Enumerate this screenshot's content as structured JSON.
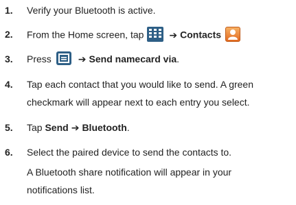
{
  "steps": [
    {
      "num": "1.",
      "text": "Verify your Bluetooth is active."
    },
    {
      "num": "2.",
      "pre": "From the Home screen, tap",
      "arrow": "➔",
      "bold": "Contacts",
      "icon1": "apps-grid-icon",
      "icon2": "contacts-icon"
    },
    {
      "num": "3.",
      "pre": "Press",
      "arrow": "➔",
      "bold": "Send namecard via",
      "post": ".",
      "icon1": "menu-icon"
    },
    {
      "num": "4.",
      "line1": "Tap each contact that you would like to send. A green",
      "line2": "checkmark will appear next to each entry you select."
    },
    {
      "num": "5.",
      "pre": "Tap",
      "bold1": "Send",
      "arrow": "➔",
      "bold2": "Bluetooth",
      "post": "."
    },
    {
      "num": "6.",
      "text": "Select the paired device to send the contacts to.",
      "note_line1": "A Bluetooth share notification will appear in your",
      "note_line2": "notifications list."
    }
  ],
  "colors": {
    "icon_blue": "#2e5f86",
    "contacts_orange": "#e36a21"
  }
}
